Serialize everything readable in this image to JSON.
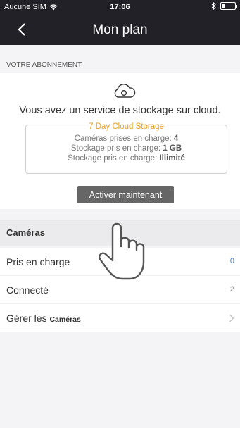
{
  "status_bar": {
    "carrier": "Aucune SIM",
    "time": "17:06",
    "battery_level": 0.3,
    "icons": [
      "wifi-icon",
      "bluetooth-icon",
      "battery-icon"
    ]
  },
  "nav": {
    "title": "Mon plan",
    "back_icon": "chevron-left-icon"
  },
  "subscription": {
    "section_title": "VOTRE ABONNEMENT",
    "icon": "cloud-icon",
    "description": "Vous avez un service de stockage sur cloud.",
    "plan_name": "7 Day Cloud Storage",
    "lines": [
      {
        "label": "Caméras prises en charge: ",
        "value": "4"
      },
      {
        "label": "Stockage pris en charge: ",
        "value": "1 GB"
      },
      {
        "label": "Stockage pris en charge: ",
        "value": "Illimité"
      }
    ],
    "activate_button": "Activer maintenant"
  },
  "cameras": {
    "section_title": "Caméras",
    "rows": [
      {
        "label": "Pris en charge",
        "value": "0",
        "value_color": "#4a7fd9"
      },
      {
        "label": "Connecté",
        "value": "2",
        "value_color": "#888888"
      },
      {
        "label": "Gérer les ",
        "label_small": "Caméras",
        "chevron_icon": "chevron-right-icon"
      }
    ]
  },
  "overlay": {
    "icon": "pointing-hand-icon"
  },
  "colors": {
    "topbar": "#212127",
    "accent_orange": "#e8a020",
    "background": "#f4f4f6"
  }
}
